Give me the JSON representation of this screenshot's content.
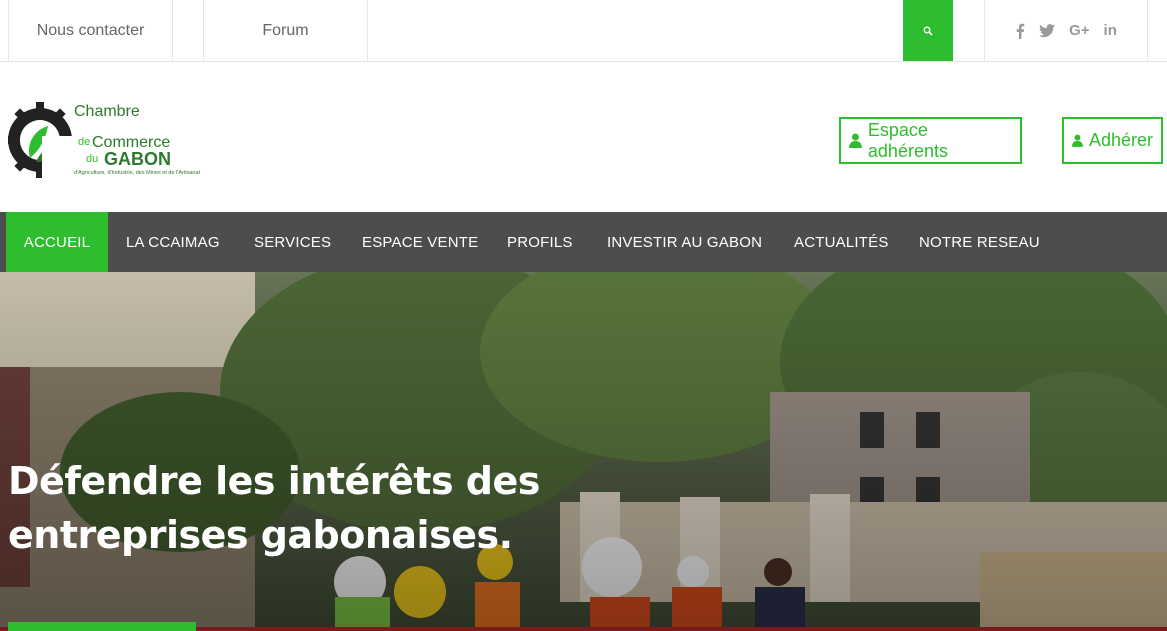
{
  "topbar": {
    "links": [
      "Nous contacter",
      "Forum"
    ],
    "search_icon": "search-icon",
    "social_icons": [
      "facebook-icon",
      "twitter-icon",
      "google-plus-icon",
      "linkedin-icon"
    ],
    "social_glyphs": [
      "f",
      "🐦",
      "G+",
      "in"
    ]
  },
  "logo": {
    "line1": "Chambre",
    "line2": "de",
    "line2b": "Commerce",
    "line3": "du",
    "line3b": "GABON",
    "tagline": "d'Agriculture, d'Industrie, des Mines et de l'Artisanat"
  },
  "header": {
    "espace_label": "Espace adhérents",
    "adherer_label": "Adhérer"
  },
  "nav": {
    "items": [
      "ACCUEIL",
      "LA CCAIMAG",
      "SERVICES",
      "ESPACE VENTE",
      "PROFILS",
      "INVESTIR AU GABON",
      "ACTUALITÉS",
      "NOTRE RESEAU"
    ]
  },
  "hero": {
    "headline_line1": "Défendre les intérêts des",
    "headline_line2": "entreprises gabonaises."
  },
  "colors": {
    "brand_green": "#2ebd2e",
    "nav_bg": "#4d4d4d",
    "logo_green": "#2d7a2d"
  }
}
